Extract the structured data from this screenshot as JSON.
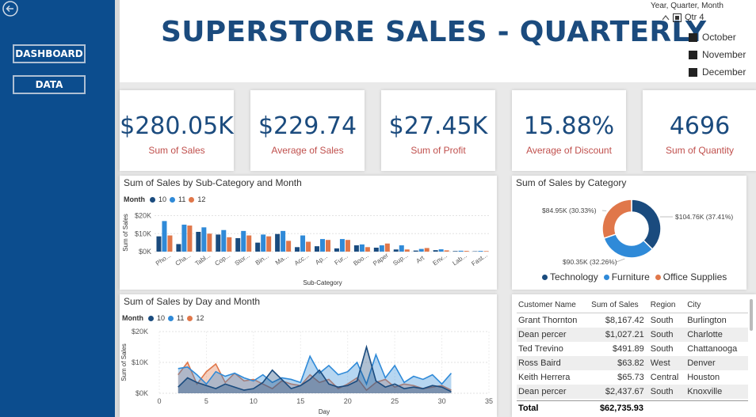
{
  "nav": {
    "dashboard_label": "DASHBOARD",
    "data_label": "DATA"
  },
  "header": {
    "title": "SUPERSTORE SALES - QUARTERLY"
  },
  "slicer": {
    "title": "Year, Quarter, Month",
    "quarter": "Qtr 4",
    "months": [
      "October",
      "November",
      "December"
    ]
  },
  "kpis": [
    {
      "value": "$280.05K",
      "label": "Sum of Sales"
    },
    {
      "value": "$229.74",
      "label": "Average of Sales"
    },
    {
      "value": "$27.45K",
      "label": "Sum of Profit"
    },
    {
      "value": "15.88%",
      "label": "Average of Discount"
    },
    {
      "value": "4696",
      "label": "Sum of Quantity"
    }
  ],
  "colors": {
    "m10": "#1a4b7e",
    "m11": "#2f8ad8",
    "m12": "#e0774a",
    "sidebar": "#0c4d8e",
    "kpi_value": "#1b4b7e",
    "kpi_label": "#c0504d"
  },
  "chart_data": [
    {
      "type": "bar",
      "title": "Sum of Sales by Sub-Category and Month",
      "legend_title": "Month",
      "legend_position": "top-left",
      "xlabel": "Sub-Category",
      "ylabel": "Sum of Sales",
      "yticks": [
        "$0K",
        "$10K",
        "$20K"
      ],
      "ylim": [
        0,
        22000
      ],
      "grid": true,
      "categories": [
        "Pho...",
        "Cha...",
        "Tabl...",
        "Cop...",
        "Stor...",
        "Bin...",
        "Ma...",
        "Acc...",
        "Ap...",
        "Fur...",
        "Boo...",
        "Paper",
        "Sup...",
        "Art",
        "Env...",
        "Lab...",
        "Fast..."
      ],
      "series": [
        {
          "name": "10",
          "values": [
            8500,
            4200,
            11000,
            9500,
            7500,
            5000,
            9800,
            2500,
            3000,
            1800,
            3500,
            2200,
            1200,
            600,
            800,
            300,
            200
          ]
        },
        {
          "name": "11",
          "values": [
            17000,
            15000,
            13500,
            12000,
            11500,
            9500,
            11500,
            9000,
            7000,
            7000,
            4000,
            3500,
            3500,
            1500,
            1300,
            500,
            400
          ]
        },
        {
          "name": "12",
          "values": [
            9000,
            14500,
            10000,
            8000,
            9000,
            8500,
            6000,
            5500,
            6500,
            6500,
            2500,
            4500,
            1200,
            2000,
            700,
            400,
            300
          ]
        }
      ]
    },
    {
      "type": "pie",
      "title": "Sum of Sales by Category",
      "legend_position": "bottom",
      "series": [
        {
          "name": "Technology",
          "value": 104760,
          "label": "$104.76K (37.41%)"
        },
        {
          "name": "Furniture",
          "value": 90350,
          "label": "$90.35K (32.26%)"
        },
        {
          "name": "Office Supplies",
          "value": 84950,
          "label": "$84.95K (30.33%)"
        }
      ]
    },
    {
      "type": "area",
      "title": "Sum of Sales by Day and Month",
      "legend_title": "Month",
      "legend_position": "top-left",
      "xlabel": "Day",
      "ylabel": "Sum of Sales",
      "xlim": [
        0,
        35
      ],
      "xticks": [
        "0",
        "5",
        "10",
        "15",
        "20",
        "25",
        "30",
        "35"
      ],
      "ylim": [
        0,
        20000
      ],
      "yticks": [
        "$0K",
        "$10K",
        "$20K"
      ],
      "grid": true,
      "x": [
        2,
        3,
        4,
        5,
        6,
        7,
        8,
        9,
        10,
        11,
        12,
        13,
        14,
        15,
        16,
        17,
        18,
        19,
        20,
        21,
        22,
        23,
        24,
        25,
        26,
        27,
        28,
        29,
        30,
        31
      ],
      "series": [
        {
          "name": "10",
          "values": [
            2000,
            5000,
            3500,
            2500,
            1500,
            3000,
            2000,
            1000,
            1500,
            3500,
            7500,
            4500,
            1500,
            2500,
            4500,
            7500,
            3000,
            2000,
            2500,
            4000,
            15000,
            4000,
            2000,
            3000,
            1500,
            2000,
            1500,
            2500,
            2000,
            500
          ]
        },
        {
          "name": "11",
          "values": [
            8000,
            8500,
            6000,
            3000,
            7000,
            5500,
            6500,
            5000,
            4000,
            6000,
            3500,
            5000,
            4500,
            3500,
            12000,
            6500,
            9000,
            6000,
            7000,
            10000,
            3000,
            12500,
            5000,
            9000,
            3500,
            5500,
            4500,
            6000,
            3000,
            6500
          ]
        },
        {
          "name": "12",
          "values": [
            6000,
            10000,
            3000,
            7000,
            9500,
            3500,
            6500,
            4000,
            4500,
            3000,
            1500,
            4000,
            3000,
            2500,
            6000,
            3500,
            4500,
            1500,
            3000,
            5000,
            1000,
            3500,
            4500,
            2000,
            3000,
            2500,
            1500,
            2000,
            2500,
            1000
          ]
        }
      ]
    }
  ],
  "table": {
    "columns": [
      "Customer Name",
      "Sum of Sales",
      "Region",
      "City"
    ],
    "rows": [
      [
        "Grant Thornton",
        "$8,167.42",
        "South",
        "Burlington"
      ],
      [
        "Dean percer",
        "$1,027.21",
        "South",
        "Charlotte"
      ],
      [
        "Ted Trevino",
        "$491.89",
        "South",
        "Chattanooga"
      ],
      [
        "Ross Baird",
        "$63.82",
        "West",
        "Denver"
      ],
      [
        "Keith Herrera",
        "$65.73",
        "Central",
        "Houston"
      ],
      [
        "Dean percer",
        "$2,437.67",
        "South",
        "Knoxville"
      ]
    ],
    "total_label": "Total",
    "total_value": "$62,735.93"
  }
}
